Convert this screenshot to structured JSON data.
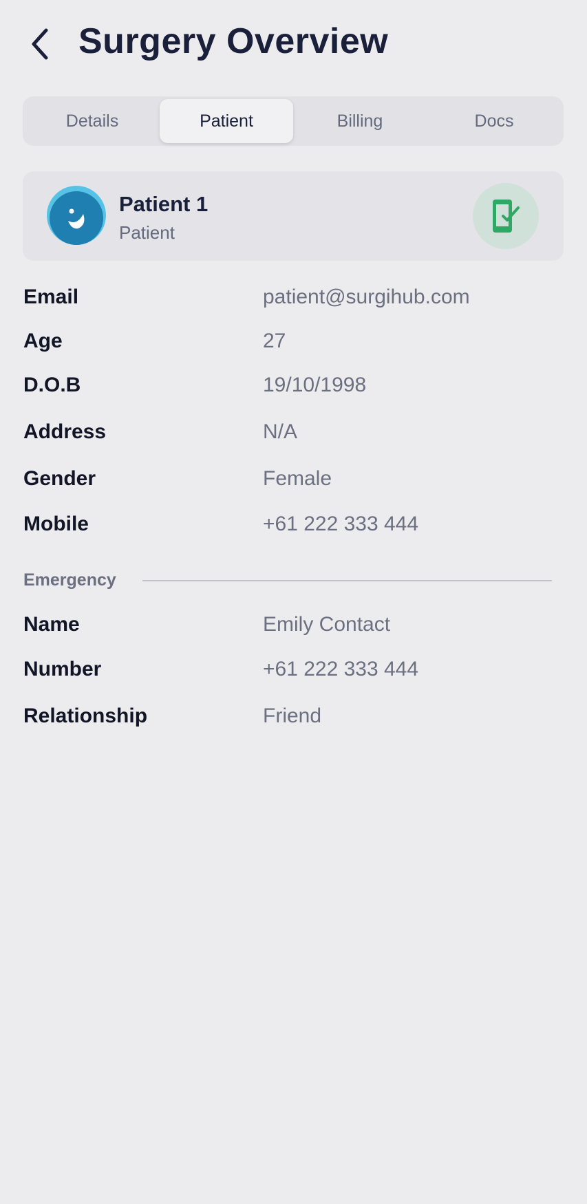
{
  "header": {
    "title": "Surgery Overview",
    "back_icon": "chevron-left-icon"
  },
  "tabs": [
    {
      "label": "Details",
      "active": false
    },
    {
      "label": "Patient",
      "active": true
    },
    {
      "label": "Billing",
      "active": false
    },
    {
      "label": "Docs",
      "active": false
    }
  ],
  "patient": {
    "name": "Patient 1",
    "role": "Patient",
    "avatar_icon": "smiley-face-icon",
    "status_icon": "phone-check-icon"
  },
  "details": [
    {
      "label": "Email",
      "value": "patient@surgihub.com"
    },
    {
      "label": "Age",
      "value": "27"
    },
    {
      "label": "D.O.B",
      "value": "19/10/1998"
    },
    {
      "label": "Address",
      "value": "N/A"
    },
    {
      "label": "Gender",
      "value": "Female"
    },
    {
      "label": "Mobile",
      "value": "+61 222 333 444"
    }
  ],
  "emergency": {
    "section_title": "Emergency",
    "fields": [
      {
        "label": "Name",
        "value": "Emily Contact"
      },
      {
        "label": "Number",
        "value": "+61 222 333 444"
      },
      {
        "label": "Relationship",
        "value": "Friend"
      }
    ]
  },
  "colors": {
    "background": "#ececee",
    "primary_text": "#1a1f3a",
    "secondary_text": "#6b6f80",
    "avatar_blue": "#1f7fb0",
    "success_green": "#2fa866"
  }
}
